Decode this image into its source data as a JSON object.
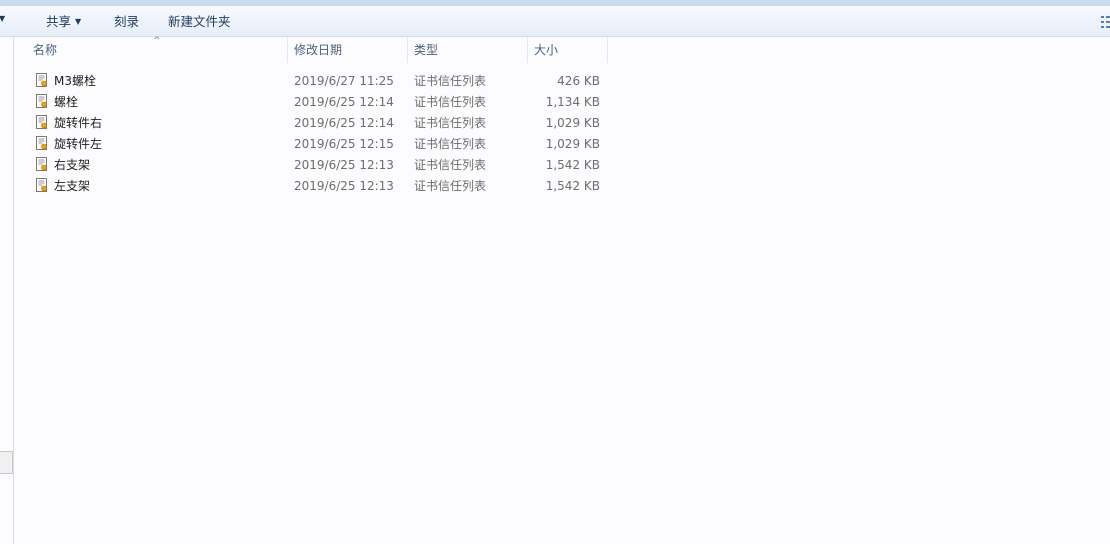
{
  "toolbar": {
    "share_label": "共享",
    "burn_label": "刻录",
    "new_folder_label": "新建文件夹"
  },
  "columns": {
    "name": "名称",
    "date": "修改日期",
    "type": "类型",
    "size": "大小"
  },
  "files": [
    {
      "name": "M3螺栓",
      "date": "2019/6/27 11:25",
      "type": "证书信任列表",
      "size": "426 KB"
    },
    {
      "name": "螺栓",
      "date": "2019/6/25 12:14",
      "type": "证书信任列表",
      "size": "1,134 KB"
    },
    {
      "name": "旋转件右",
      "date": "2019/6/25 12:14",
      "type": "证书信任列表",
      "size": "1,029 KB"
    },
    {
      "name": "旋转件左",
      "date": "2019/6/25 12:15",
      "type": "证书信任列表",
      "size": "1,029 KB"
    },
    {
      "name": "右支架",
      "date": "2019/6/25 12:13",
      "type": "证书信任列表",
      "size": "1,542 KB"
    },
    {
      "name": "左支架",
      "date": "2019/6/25 12:13",
      "type": "证书信任列表",
      "size": "1,542 KB"
    }
  ],
  "icons": {
    "file": "certificate-trust-list-icon",
    "sort": "sort-ascending-icon",
    "view": "view-options-icon"
  }
}
